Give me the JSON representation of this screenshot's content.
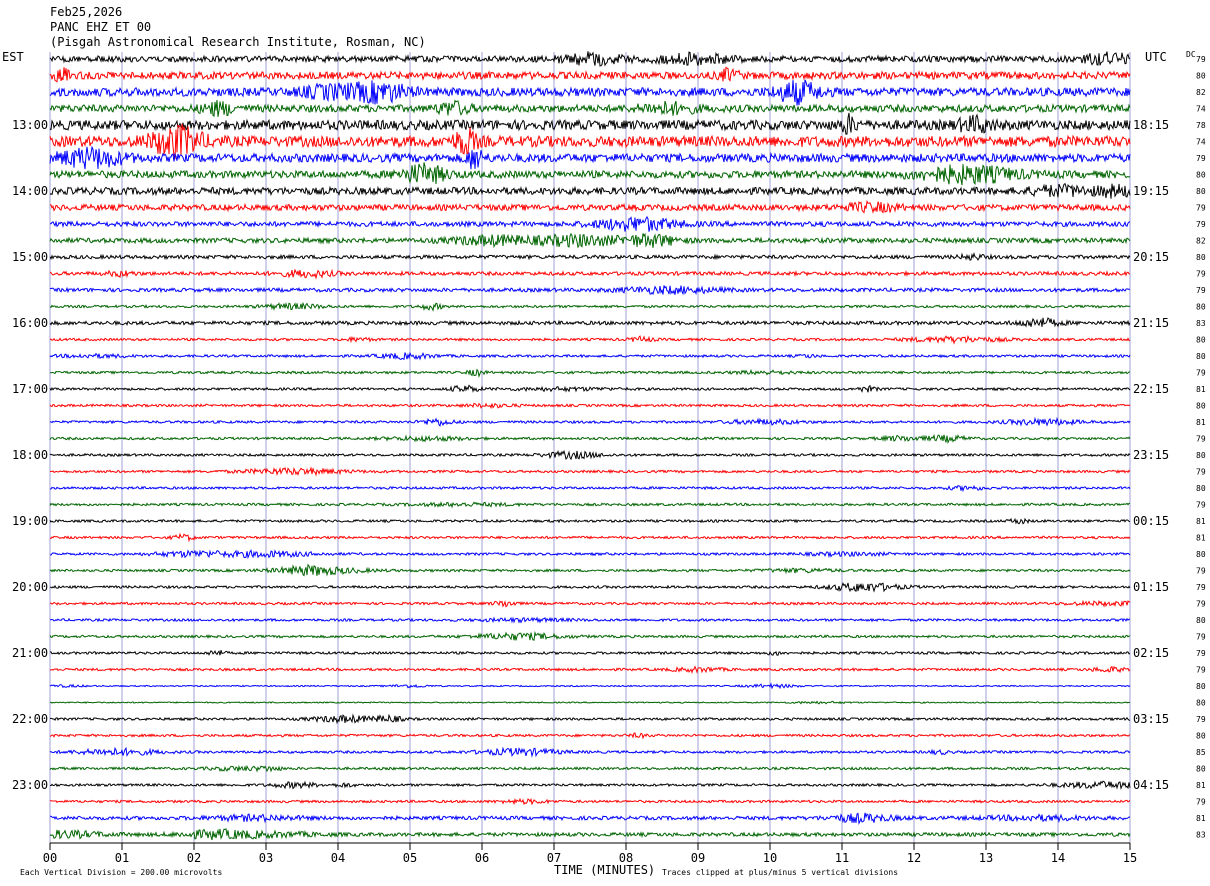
{
  "header": {
    "date": "Feb25,2026",
    "station": "PANC EHZ ET 00",
    "location": "(Pisgah Astronomical Research Institute, Rosman, NC)"
  },
  "chart_data": {
    "type": "line",
    "title": "Feb25,2026",
    "left_axis_label": "EST",
    "right_axis_label": "UTC",
    "dc_label": "DC",
    "xlabel": "TIME (MINUTES)",
    "x_ticks": [
      "00",
      "01",
      "02",
      "03",
      "04",
      "05",
      "06",
      "07",
      "08",
      "09",
      "10",
      "11",
      "12",
      "13",
      "14",
      "15"
    ],
    "xlim": [
      0,
      15
    ],
    "grid": true,
    "trace_colors": [
      "#000000",
      "#ff0000",
      "#0000ff",
      "#006400"
    ],
    "left_hour_labels": [
      "13:00",
      "14:00",
      "15:00",
      "16:00",
      "17:00",
      "18:00",
      "19:00",
      "20:00",
      "21:00",
      "22:00",
      "23:00"
    ],
    "right_hour_labels": [
      "18:15",
      "19:15",
      "20:15",
      "21:15",
      "22:15",
      "23:15",
      "00:15",
      "01:15",
      "02:15",
      "03:15",
      "04:15"
    ],
    "dc_values": [
      "79",
      "80",
      "82",
      "74",
      "78",
      "74",
      "79",
      "80",
      "80",
      "79",
      "79",
      "82",
      "80",
      "79",
      "79",
      "80",
      "83",
      "80",
      "80",
      "79",
      "81",
      "80",
      "81",
      "79",
      "80",
      "79",
      "80",
      "79",
      "81",
      "81",
      "80",
      "79",
      "79",
      "79",
      "80",
      "79",
      "79",
      "79",
      "80",
      "80",
      "79",
      "80",
      "85",
      "80",
      "81",
      "79",
      "81",
      "83"
    ],
    "trace_amplitudes": [
      5,
      6,
      7,
      6,
      8,
      9,
      7,
      6,
      6,
      5,
      4,
      4,
      3,
      3,
      3,
      2,
      3,
      2,
      2,
      2,
      2,
      2,
      2,
      2,
      2,
      2,
      2,
      2,
      2,
      2,
      2,
      2,
      2,
      2,
      2,
      2,
      2,
      2,
      1,
      1,
      2,
      2,
      2,
      2,
      2,
      2,
      3,
      3
    ],
    "footer_left": "Each Vertical Division =  200.00 microvolts",
    "footer_right": "Traces clipped at plus/minus 5 vertical divisions"
  }
}
